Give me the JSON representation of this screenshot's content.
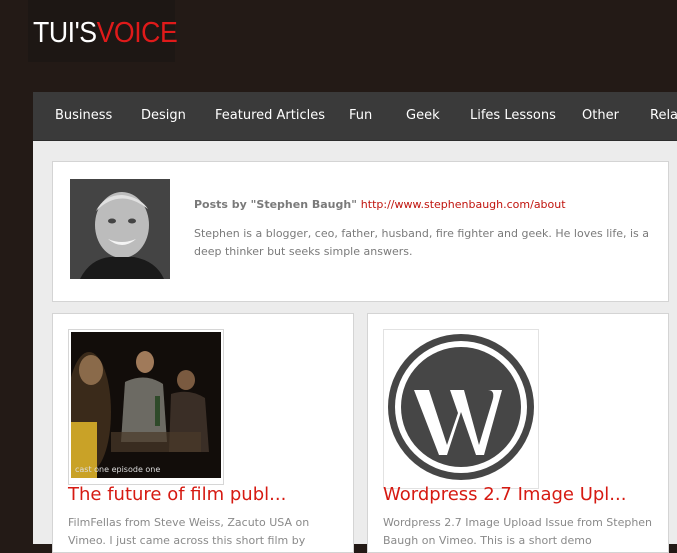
{
  "site": {
    "logo_part1": "TUI'S",
    "logo_part2": "VOICE",
    "accent_color": "#e01a1a"
  },
  "nav": {
    "items": [
      {
        "label": "Business"
      },
      {
        "label": "Design"
      },
      {
        "label": "Featured Articles"
      },
      {
        "label": "Fun"
      },
      {
        "label": "Geek"
      },
      {
        "label": "Lifes Lessons"
      },
      {
        "label": "Other"
      },
      {
        "label": "Relat"
      }
    ]
  },
  "author": {
    "posts_by": "Posts by \"Stephen Baugh\"",
    "link": "http://www.stephenbaugh.com/about",
    "bio": "Stephen is a blogger, ceo, father, husband, fire fighter and geek. He loves life, is a deep thinker but seeks simple answers."
  },
  "posts": [
    {
      "title": "The future of film publ...",
      "excerpt": "FilmFellas from Steve Weiss, Zacuto USA on Vimeo. I just came across this short film by",
      "thumb_caption": "cast one  episode one"
    },
    {
      "title": "Wordpress 2.7 Image Upl...",
      "excerpt": "Wordpress 2.7 Image Upload Issue from Stephen Baugh on Vimeo. This is a short demo",
      "thumb_icon": "wordpress-logo-icon"
    }
  ]
}
